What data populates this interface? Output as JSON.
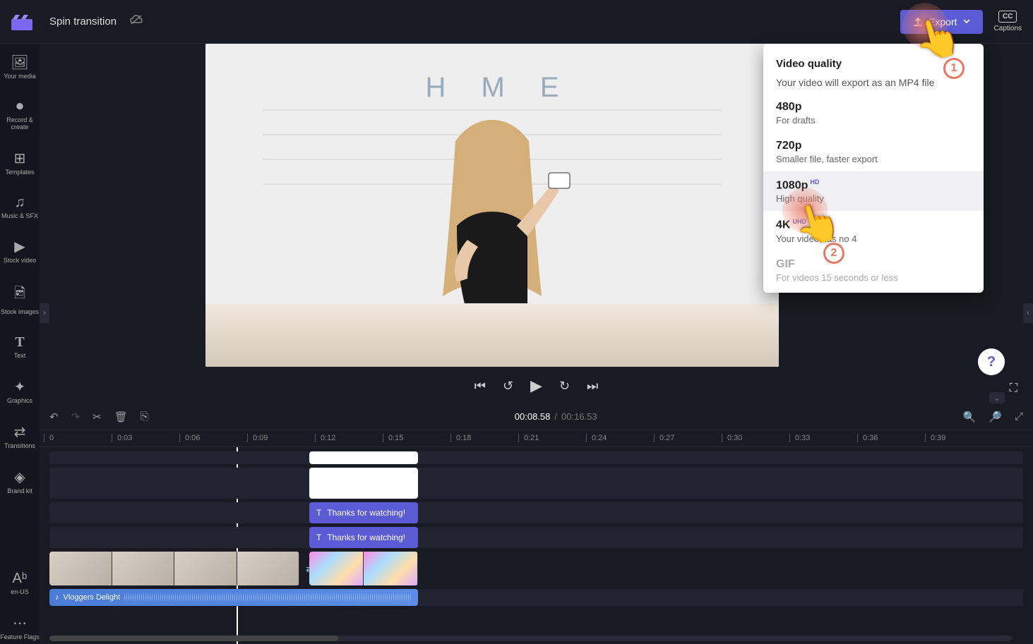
{
  "topbar": {
    "project_title": "Spin transition",
    "export_label": "Export",
    "captions_label": "Captions"
  },
  "sidebar": {
    "items": [
      {
        "label": "Your media",
        "icon": "🖼"
      },
      {
        "label": "Record & create",
        "icon": "⏺"
      },
      {
        "label": "Templates",
        "icon": "⊞"
      },
      {
        "label": "Music & SFX",
        "icon": "♫"
      },
      {
        "label": "Stock video",
        "icon": "▶"
      },
      {
        "label": "Stock images",
        "icon": "🖻"
      },
      {
        "label": "Text",
        "icon": "T"
      },
      {
        "label": "Graphics",
        "icon": "✦"
      },
      {
        "label": "Transitions",
        "icon": "⇄"
      },
      {
        "label": "Brand kit",
        "icon": "◈"
      }
    ],
    "bottom_items": [
      {
        "label": "en-US",
        "icon": "Aᵇ"
      },
      {
        "label": "Feature Flags",
        "icon": "⋯"
      }
    ]
  },
  "export_dropdown": {
    "title": "Video quality",
    "subtitle": "Your video will export as an MP4 file",
    "options": [
      {
        "name": "480p",
        "desc": "For drafts",
        "badge": ""
      },
      {
        "name": "720p",
        "desc": "Smaller file, faster export",
        "badge": ""
      },
      {
        "name": "1080p",
        "desc": "High quality",
        "badge": "HD"
      },
      {
        "name": "4K",
        "desc": "Your video has no 4",
        "badge": "UHD"
      },
      {
        "name": "GIF",
        "desc": "For videos 15 seconds or less",
        "badge": ""
      }
    ]
  },
  "timeline": {
    "current_time": "00:08.58",
    "total_time": "00:16.53",
    "ruler": [
      "0",
      "0:03",
      "0:06",
      "0:09",
      "0:12",
      "0:15",
      "0:18",
      "0:21",
      "0:24",
      "0:27",
      "0:30",
      "0:33",
      "0:36",
      "0:39"
    ],
    "text_clip_label": "Thanks for watching!",
    "audio_clip_label": "Vloggers Delight"
  },
  "annotations": {
    "step1": "1",
    "step2": "2"
  }
}
